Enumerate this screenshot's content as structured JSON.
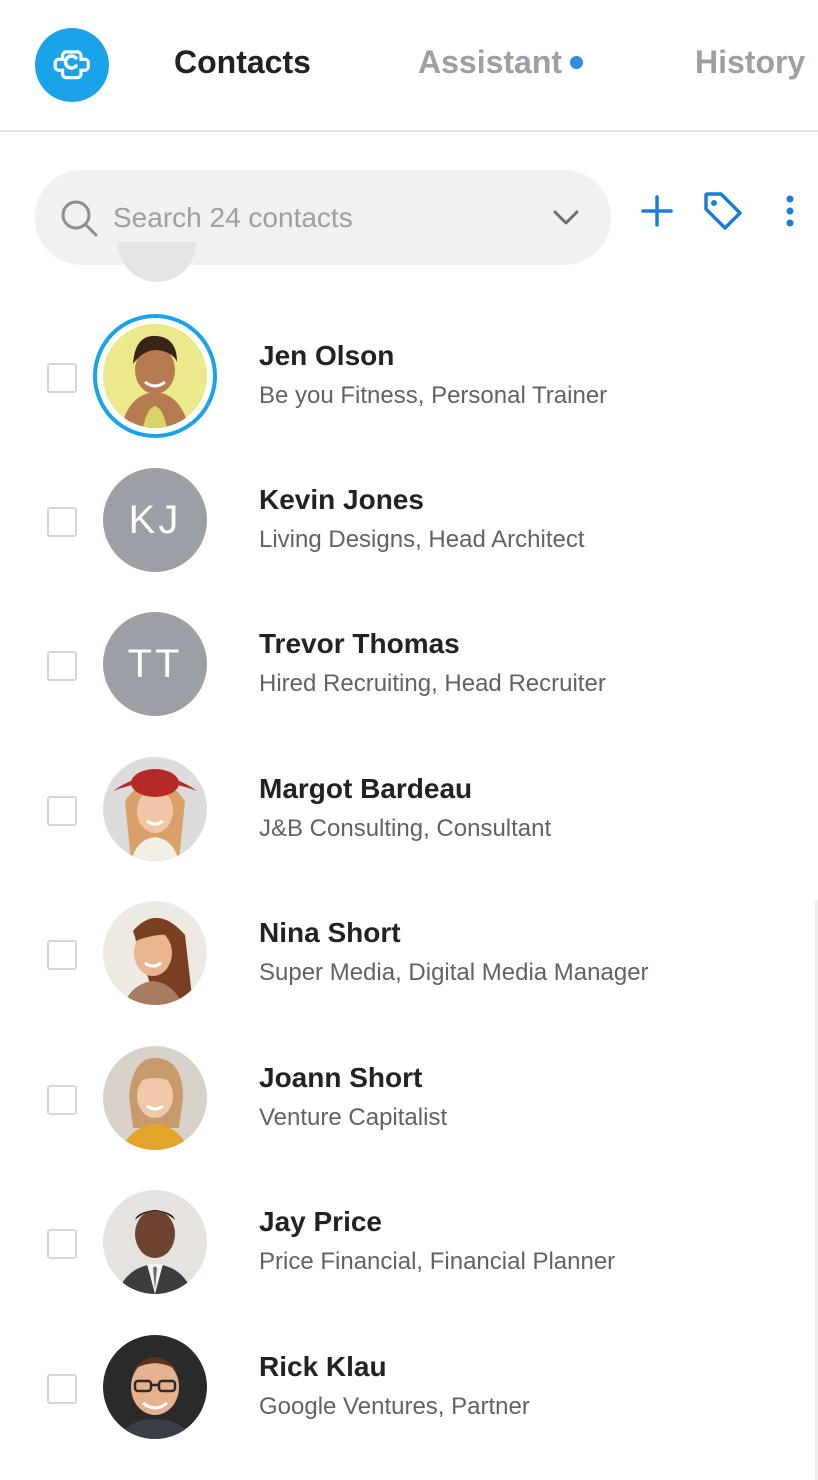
{
  "header": {
    "tabs": [
      {
        "label": "Contacts",
        "active": true
      },
      {
        "label": "Assistant",
        "active": false,
        "has_notification_dot": true
      },
      {
        "label": "History",
        "active": false
      }
    ],
    "logo_icon": "app-logo-icon",
    "accent_color": "#1aa3e8"
  },
  "search": {
    "placeholder": "Search 24 contacts",
    "value": ""
  },
  "toolbar": {
    "add_icon": "plus-icon",
    "tag_icon": "tag-icon",
    "more_icon": "more-vertical-icon"
  },
  "contacts": [
    {
      "name": "Jen Olson",
      "subtitle": "Be you Fitness, Personal Trainer",
      "avatar": "photo",
      "selected_ring": true
    },
    {
      "name": "Kevin Jones",
      "subtitle": "Living Designs, Head Architect",
      "avatar": "initials",
      "initials": "KJ"
    },
    {
      "name": "Trevor Thomas",
      "subtitle": "Hired Recruiting, Head Recruiter",
      "avatar": "initials",
      "initials": "TT"
    },
    {
      "name": "Margot Bardeau",
      "subtitle": "J&B Consulting, Consultant",
      "avatar": "photo"
    },
    {
      "name": "Nina Short",
      "subtitle": "Super Media, Digital Media Manager",
      "avatar": "photo"
    },
    {
      "name": "Joann Short",
      "subtitle": "Venture Capitalist",
      "avatar": "photo"
    },
    {
      "name": "Jay Price",
      "subtitle": "Price Financial, Financial Planner",
      "avatar": "photo"
    },
    {
      "name": "Rick Klau",
      "subtitle": "Google Ventures, Partner",
      "avatar": "photo"
    }
  ]
}
